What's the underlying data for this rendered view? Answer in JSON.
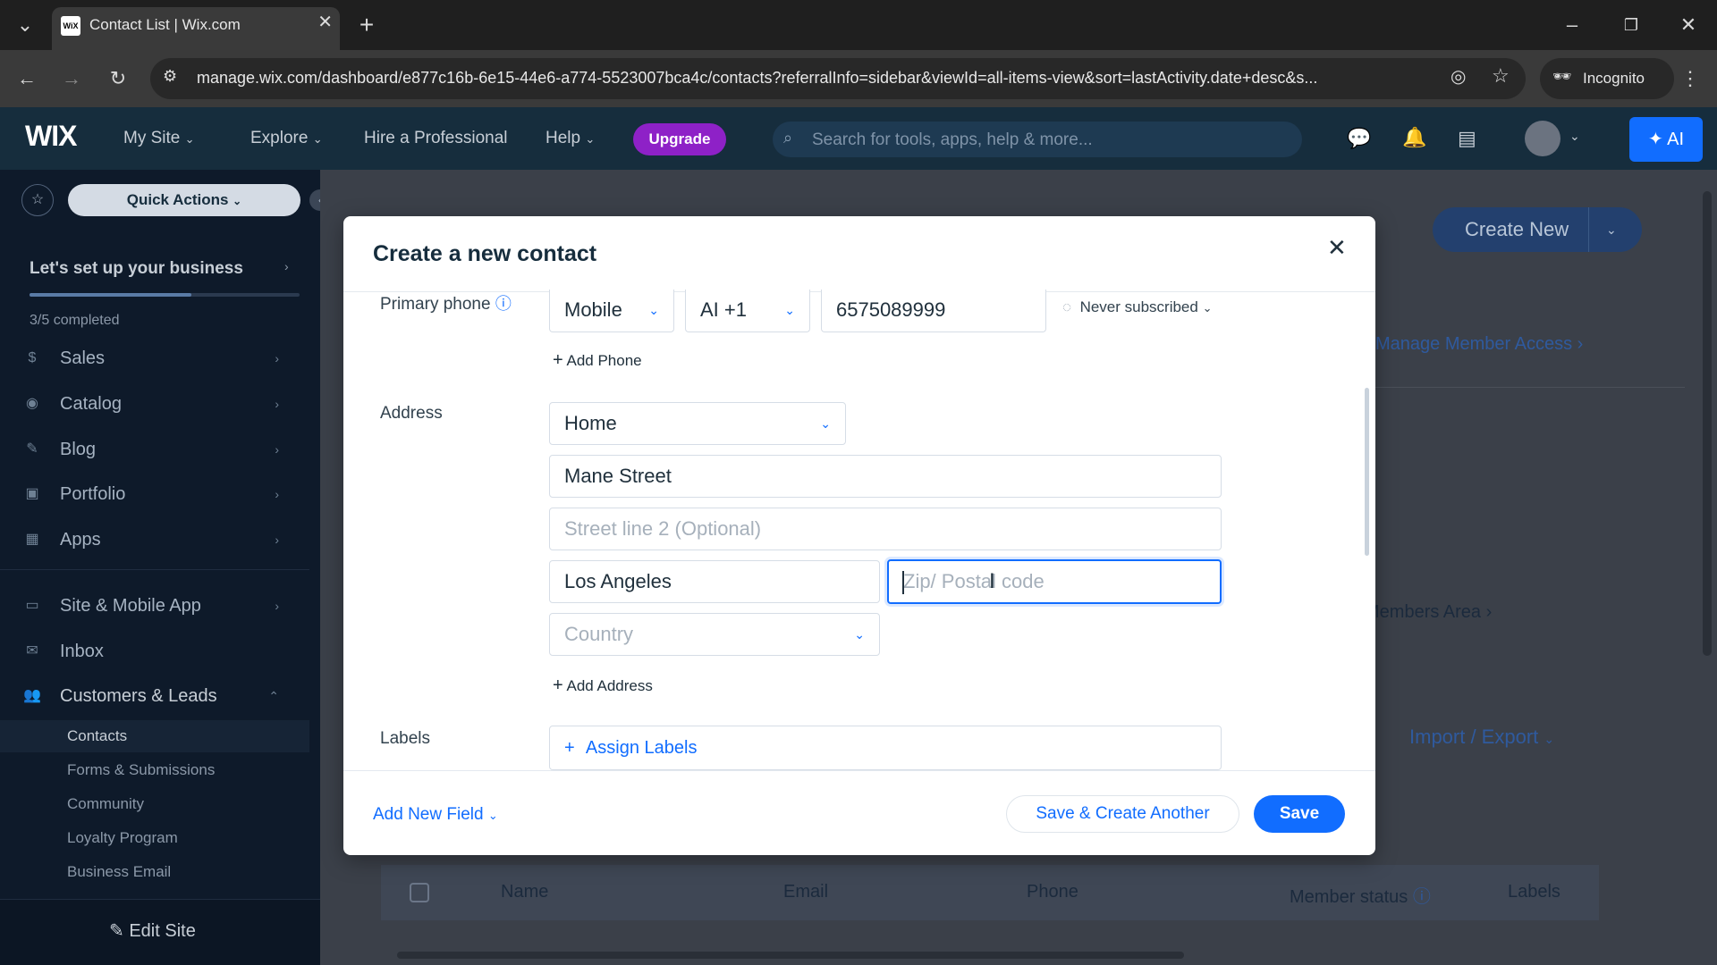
{
  "browser": {
    "tab_title": "Contact List | Wix.com",
    "url": "manage.wix.com/dashboard/e877c16b-6e15-44e6-a774-5523007bca4c/contacts?referralInfo=sidebar&viewId=all-items-view&sort=lastActivity.date+desc&s...",
    "incognito_label": "Incognito"
  },
  "wix_header": {
    "logo": "WIX",
    "nav": [
      "My Site",
      "Explore",
      "Hire a Professional",
      "Help"
    ],
    "upgrade_label": "Upgrade",
    "search_placeholder": "Search for tools, apps, help & more...",
    "ai_label": "AI"
  },
  "sidebar": {
    "quick_actions": "Quick Actions",
    "setup_title": "Let's set up your business",
    "setup_progress_text": "3/5 completed",
    "setup_progress_fraction": 0.6,
    "items": [
      {
        "label": "Sales",
        "icon": "sales-icon"
      },
      {
        "label": "Catalog",
        "icon": "catalog-icon"
      },
      {
        "label": "Blog",
        "icon": "blog-icon"
      },
      {
        "label": "Portfolio",
        "icon": "portfolio-icon"
      },
      {
        "label": "Apps",
        "icon": "apps-icon"
      },
      {
        "label": "Site & Mobile App",
        "icon": "site-mobile-icon"
      },
      {
        "label": "Inbox",
        "icon": "inbox-icon"
      },
      {
        "label": "Customers & Leads",
        "icon": "customers-icon"
      }
    ],
    "sub_items": [
      "Contacts",
      "Forms & Submissions",
      "Community",
      "Loyalty Program",
      "Business Email"
    ],
    "edit_site": "Edit Site"
  },
  "background_page": {
    "create_new": "Create New",
    "manage_member_access": "Manage Member Access",
    "members_area": "Members Area",
    "import_export": "Import / Export",
    "table_headers": [
      "Name",
      "Email",
      "Phone",
      "Member status",
      "Labels"
    ]
  },
  "modal": {
    "title": "Create a new contact",
    "primary_phone_label": "Primary phone",
    "phone_type": "Mobile",
    "country_code": "AI +1",
    "phone_number": "6575089999",
    "subscription_status": "Never subscribed",
    "add_phone": "Add Phone",
    "address_label": "Address",
    "address_type": "Home",
    "street": "Mane Street",
    "street2_placeholder": "Street line 2 (Optional)",
    "city": "Los Angeles",
    "zip_placeholder": "Zip/ Postal code",
    "country_placeholder": "Country",
    "add_address": "Add Address",
    "labels_label": "Labels",
    "assign_labels": "Assign Labels",
    "add_new_field": "Add New Field",
    "save_create_another": "Save & Create Another",
    "save": "Save"
  },
  "colors": {
    "wix_blue": "#116dff",
    "upgrade_purple": "#8e21c7",
    "sidebar_bg": "#0e1a2a"
  }
}
